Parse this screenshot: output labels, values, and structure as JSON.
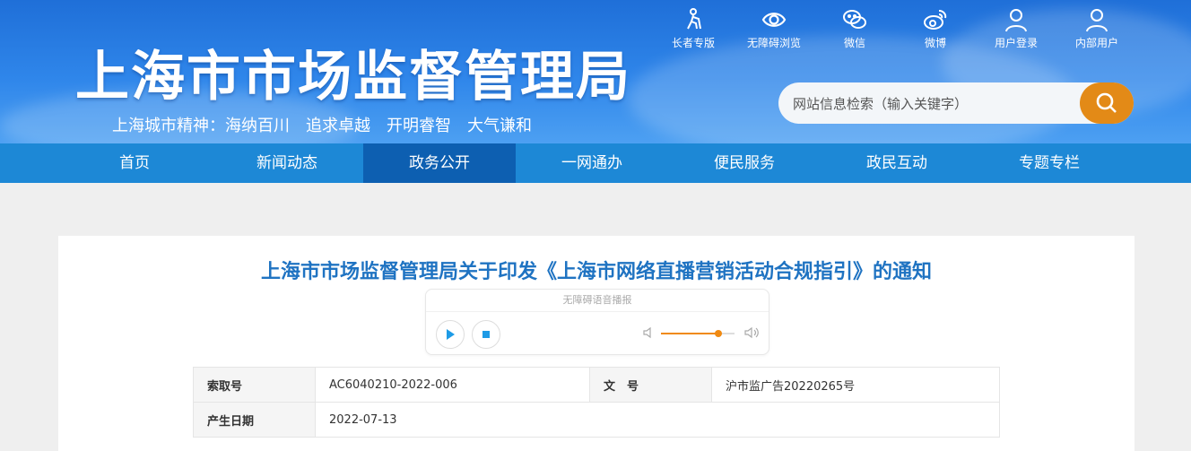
{
  "header": {
    "site_title": "上海市市场监督管理局",
    "motto": "上海城市精神：海纳百川　追求卓越　开明睿智　大气谦和"
  },
  "tools": [
    {
      "label": "长者专版",
      "icon": "elder-icon"
    },
    {
      "label": "无障碍浏览",
      "icon": "eye-icon"
    },
    {
      "label": "微信",
      "icon": "wechat-icon"
    },
    {
      "label": "微博",
      "icon": "weibo-icon"
    },
    {
      "label": "用户登录",
      "icon": "user-icon"
    },
    {
      "label": "内部用户",
      "icon": "user-icon"
    }
  ],
  "search": {
    "placeholder": "网站信息检索（输入关键字）",
    "icon": "search-icon"
  },
  "nav": [
    "首页",
    "新闻动态",
    "政务公开",
    "一网通办",
    "便民服务",
    "政民互动",
    "专题专栏"
  ],
  "nav_active": "政务公开",
  "article": {
    "title": "上海市市场监督管理局关于印发《上海市网络直播营销活动合规指引》的通知"
  },
  "player": {
    "label": "无障碍语音播报",
    "volume": 0.78,
    "accent": "#f08a12"
  },
  "meta": {
    "k_index": "索取号",
    "v_index": "AC6040210-2022-006",
    "k_docno": "文　号",
    "v_docno": "沪市监广告20220265号",
    "k_date": "产生日期",
    "v_date": "2022-07-13"
  },
  "colors": {
    "nav_bg": "#1d88d6",
    "nav_active": "#0d5fb1",
    "title": "#1f73c2",
    "search_btn": "#e38a17"
  }
}
